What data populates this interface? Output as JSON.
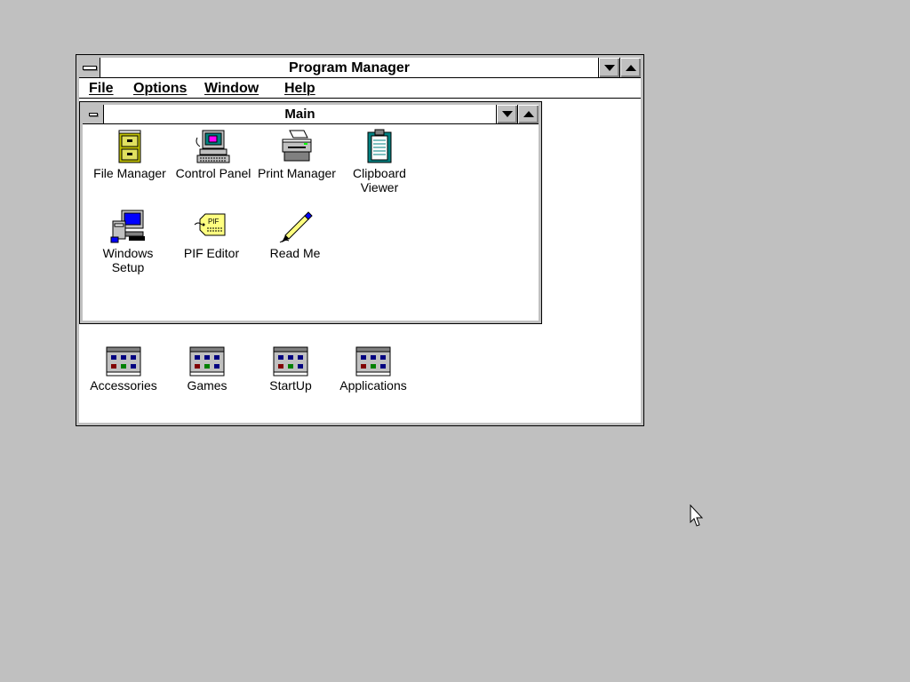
{
  "program_manager": {
    "title": "Program Manager",
    "menu": [
      "File",
      "Options",
      "Window",
      "Help"
    ]
  },
  "main_group": {
    "title": "Main",
    "icons": [
      {
        "label": "File Manager",
        "icon": "file-cabinet-icon"
      },
      {
        "label": "Control Panel",
        "icon": "control-panel-icon"
      },
      {
        "label": "Print Manager",
        "icon": "printer-icon"
      },
      {
        "label": "Clipboard\nViewer",
        "icon": "clipboard-icon"
      },
      {
        "label": "Windows\nSetup",
        "icon": "computer-setup-icon"
      },
      {
        "label": "PIF Editor",
        "icon": "pif-tag-icon"
      },
      {
        "label": "Read Me",
        "icon": "pen-icon"
      }
    ]
  },
  "minimized_groups": [
    {
      "label": "Accessories",
      "icon": "program-group-icon"
    },
    {
      "label": "Games",
      "icon": "program-group-icon"
    },
    {
      "label": "StartUp",
      "icon": "program-group-icon"
    },
    {
      "label": "Applications",
      "icon": "program-group-icon"
    }
  ],
  "colors": {
    "desktop": "#c0c0c0",
    "window_bg": "#ffffff",
    "frame": "#c0c0c0"
  }
}
